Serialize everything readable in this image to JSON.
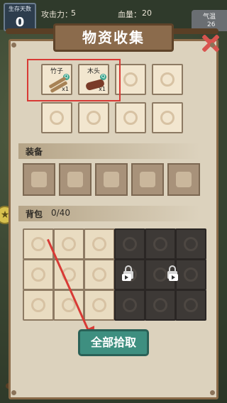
{
  "hud": {
    "days_label": "生存天数",
    "days_value": "0",
    "attack_label": "攻击力：",
    "attack_value": "5",
    "hp_label": "血量：",
    "hp_value": "20",
    "temp_label": "气温",
    "temp_value": "26"
  },
  "panel": {
    "title": "物资收集",
    "found_items": [
      {
        "name": "竹子",
        "count": "x1",
        "icon": "bamboo-icon"
      },
      {
        "name": "木头",
        "count": "x1",
        "icon": "wood-log-icon"
      }
    ],
    "equip_label": "装备",
    "equip_slots": [
      "knife-icon",
      "helmet-icon",
      "armor-icon",
      "pants-icon",
      "shoes-icon"
    ],
    "bag_label": "背包",
    "bag_count": "0/40",
    "collect_all_label": "全部拾取"
  },
  "colors": {
    "accent": "#3e8f80",
    "highlight": "#d83a35",
    "panel_bg": "#dcd2bd"
  }
}
